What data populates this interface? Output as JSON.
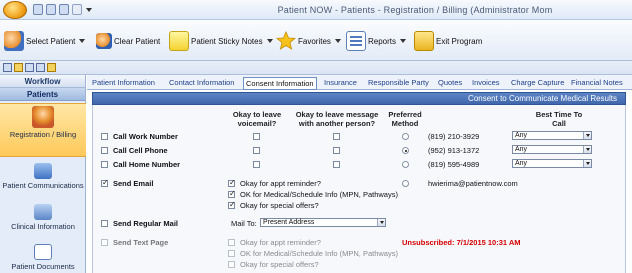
{
  "window": {
    "title": "Patient NOW - Patients - Registration / Billing (Administrator Mom"
  },
  "toolbar": {
    "select_patient": "Select Patient",
    "clear_patient": "Clear Patient",
    "sticky_notes": "Patient Sticky Notes",
    "favorites": "Favorites",
    "reports": "Reports",
    "exit_program": "Exit Program"
  },
  "sidebar": {
    "workflow": "Workflow",
    "patients": "Patients",
    "items": [
      {
        "label": "Registration / Billing",
        "icon": "registration-billing-icon"
      },
      {
        "label": "Patient Communications",
        "icon": "communications-icon"
      },
      {
        "label": "Clinical Information",
        "icon": "clinical-icon"
      },
      {
        "label": "Patient Documents",
        "icon": "documents-icon"
      }
    ]
  },
  "tabs": [
    "Patient Information",
    "Contact Information",
    "Consent Information",
    "Insurance",
    "Responsible Party",
    "Quotes",
    "Invoices",
    "Charge Capture",
    "Financial Notes"
  ],
  "active_tab": "Consent Information",
  "banner": "Consent to Communicate Medical Results",
  "columns": {
    "voicemail": "Okay to leave voicemail?",
    "other_person": "Okay to leave message with another person?",
    "preferred": "Preferred Method",
    "best_time": "Best Time To Call"
  },
  "rows": {
    "work": {
      "label": "Call Work Number",
      "phone": "(819) 210-3929",
      "time": "Any"
    },
    "cell": {
      "label": "Call Cell Phone",
      "phone": "(952) 913-1372",
      "time": "Any"
    },
    "home": {
      "label": "Call Home Number",
      "phone": "(819) 595-4989",
      "time": "Any"
    }
  },
  "email": {
    "label": "Send Email",
    "address": "hwierima@patientnow.com",
    "options": [
      "Okay for appt reminder?",
      "OK for Medical/Schedule Info (MPN, Pathways)",
      "Okay for special offers?"
    ]
  },
  "mail": {
    "label": "Send Regular Mail",
    "mail_to_label": "Mail To:",
    "mail_to_value": "Present Address"
  },
  "text": {
    "label": "Send Text Page",
    "unsubscribed": "Unsubscribed: 7/1/2015 10:31 AM",
    "options": [
      "Okay for appt reminder?",
      "OK for Medical/Schedule Info (MPN, Pathways)",
      "Okay for special offers?"
    ]
  },
  "colors": {
    "banner": "#4a72b6",
    "active_sidebar": "#ffd27a",
    "unsubscribed": "#d40000"
  }
}
